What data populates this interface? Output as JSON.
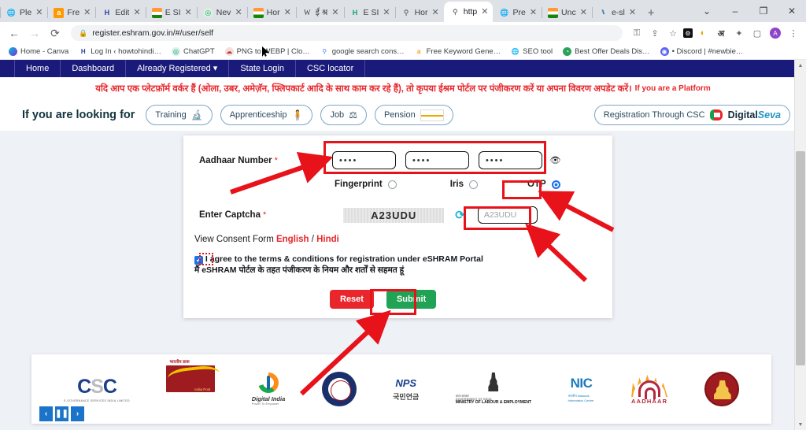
{
  "browser": {
    "tabs": [
      {
        "title": "Ple",
        "favicon": "globe-icon"
      },
      {
        "title": "Fre",
        "favicon": "amazon-icon"
      },
      {
        "title": "Edit",
        "favicon": "h-icon"
      },
      {
        "title": "E SI",
        "favicon": "esic-icon"
      },
      {
        "title": "Nev",
        "favicon": "whatsapp-icon"
      },
      {
        "title": "Hor",
        "favicon": "india-flag-icon"
      },
      {
        "title": "ई श्र",
        "favicon": "wikipedia-icon"
      },
      {
        "title": "E SI",
        "favicon": "h-icon"
      },
      {
        "title": "Hor",
        "favicon": "emblem-icon"
      },
      {
        "title": "http",
        "favicon": "emblem-icon",
        "active": true
      },
      {
        "title": "Pre",
        "favicon": "globe-icon"
      },
      {
        "title": "Unc",
        "favicon": "india-flag-icon"
      },
      {
        "title": "e-sl",
        "favicon": "chart-icon"
      }
    ],
    "new_tab_label": "+",
    "tab_close_label": "✕",
    "tab_search_label": "⌄",
    "window_minimize": "–",
    "window_maximize": "❐",
    "window_close": "✕",
    "back_label": "←",
    "forward_label": "→",
    "reload_label": "⟳",
    "url": "register.eshram.gov.in/#/user/self",
    "lock_label": "🔒",
    "toolbar_icons": [
      "key-icon",
      "share-icon",
      "star-icon",
      "extension-dark-icon",
      "moon-icon",
      "hindi-icon",
      "puzzle-icon",
      "sidepanel-icon"
    ],
    "profile_initial": "A",
    "menu_label": "⋮",
    "bookmarks": [
      {
        "label": "Home - Canva",
        "favicon": "canva-icon"
      },
      {
        "label": "Log In ‹ howtohindi…",
        "favicon": "wordpress-icon"
      },
      {
        "label": "ChatGPT",
        "favicon": "chatgpt-icon"
      },
      {
        "label": "PNG to WEBP | Clo…",
        "favicon": "cloud-icon"
      },
      {
        "label": "google search cons…",
        "favicon": "search-console-icon"
      },
      {
        "label": "Free Keyword Gene…",
        "favicon": "amazon-icon"
      },
      {
        "label": "SEO tool",
        "favicon": "globe-icon"
      },
      {
        "label": "Best Offer Deals Dis…",
        "favicon": "telegram-icon"
      },
      {
        "label": "• Discord | #newbie…",
        "favicon": "discord-icon"
      }
    ]
  },
  "site": {
    "nav": [
      {
        "label": "Home"
      },
      {
        "label": "Dashboard"
      },
      {
        "label": "Already Registered ▾"
      },
      {
        "label": "State Login"
      },
      {
        "label": "CSC locator"
      }
    ],
    "marquee_hindi": "यदि आप एक प्लेटफ़ॉर्म वर्कर हैं (ओला, उबर, अमेज़ॅन, फ्लिपकार्ट आदि के साथ काम कर रहे हैं), तो कृपया ईश्रम पोर्टल पर पंजीकरण करें या अपना विवरण अपडेट करें।",
    "marquee_english": "If you are a Platform",
    "looking_for_label": "If you are looking for",
    "pills": [
      {
        "label": "Training",
        "icon": "microscope-icon"
      },
      {
        "label": "Apprenticeship",
        "icon": "worker-icon"
      },
      {
        "label": "Job",
        "icon": "scale-icon"
      },
      {
        "label": "Pension",
        "icon": "pension-card-icon"
      }
    ],
    "csc_pill": {
      "label": "Registration Through CSC",
      "brand_bold": "Digital",
      "brand_italic": "Seva"
    }
  },
  "form": {
    "aadhaar_label": "Aadhaar Number",
    "required_mark": "*",
    "aadhaar_fields": [
      "••••",
      "••••",
      "••••"
    ],
    "eye_icon": "eye-icon",
    "auth_options": [
      {
        "label": "Fingerprint",
        "selected": false
      },
      {
        "label": "Iris",
        "selected": false
      },
      {
        "label": "OTP",
        "selected": true
      }
    ],
    "captcha_label": "Enter Captcha",
    "captcha_image_text": "A23UDU",
    "captcha_refresh_icon": "refresh-icon",
    "captcha_input_value": "A23UDU",
    "consent_prefix": "View Consent Form ",
    "consent_english": "English",
    "consent_sep": " / ",
    "consent_hindi": "Hindi",
    "agree_checked": true,
    "agree_check_glyph": "✓",
    "agree_line1": "I agree to the terms & conditions for registration under eSHRAM Portal",
    "agree_line2": "मैं eSHRAM पोर्टल के तहत पंजीकरण के नियम और शर्तों से सहमत हूं",
    "reset_label": "Reset",
    "submit_label": "Submit"
  },
  "logos": [
    {
      "name": "csc-logo",
      "c1": "C",
      "c2": "S",
      "c3": "C",
      "caption": "E-GOVERNANCE SERVICES INDIA LIMITED"
    },
    {
      "name": "india-post-logo",
      "hindi": "भारतीय डाक",
      "caption": "India Post"
    },
    {
      "name": "digital-india-logo",
      "t1": "Digital India",
      "t2": "Power To Empower"
    },
    {
      "name": "epfo-logo",
      "caption": ""
    },
    {
      "name": "nps-logo",
      "text": "NPS",
      "korean": "국민연금"
    },
    {
      "name": "ministry-of-labour-logo",
      "m1": "भारत सरकार",
      "m2": "GOVERNMENT OF INDIA",
      "m3": "MINISTRY OF LABOUR & EMPLOYMENT"
    },
    {
      "name": "nic-logo",
      "text": "NIC",
      "sub": "भारतीय National Informatics Centre"
    },
    {
      "name": "aadhaar-logo",
      "text": "AADHAAR"
    },
    {
      "name": "state-emblem-logo",
      "caption": ""
    }
  ],
  "carousel": {
    "prev": "‹",
    "pause": "❚❚",
    "next": "›"
  },
  "scrollbar": {
    "up": "▲",
    "down": "▼"
  },
  "colors": {
    "navy": "#1a1a7a",
    "red": "#e8262b",
    "green": "#21a355",
    "blue": "#1a73e8",
    "annotation_red": "#e8121a"
  }
}
